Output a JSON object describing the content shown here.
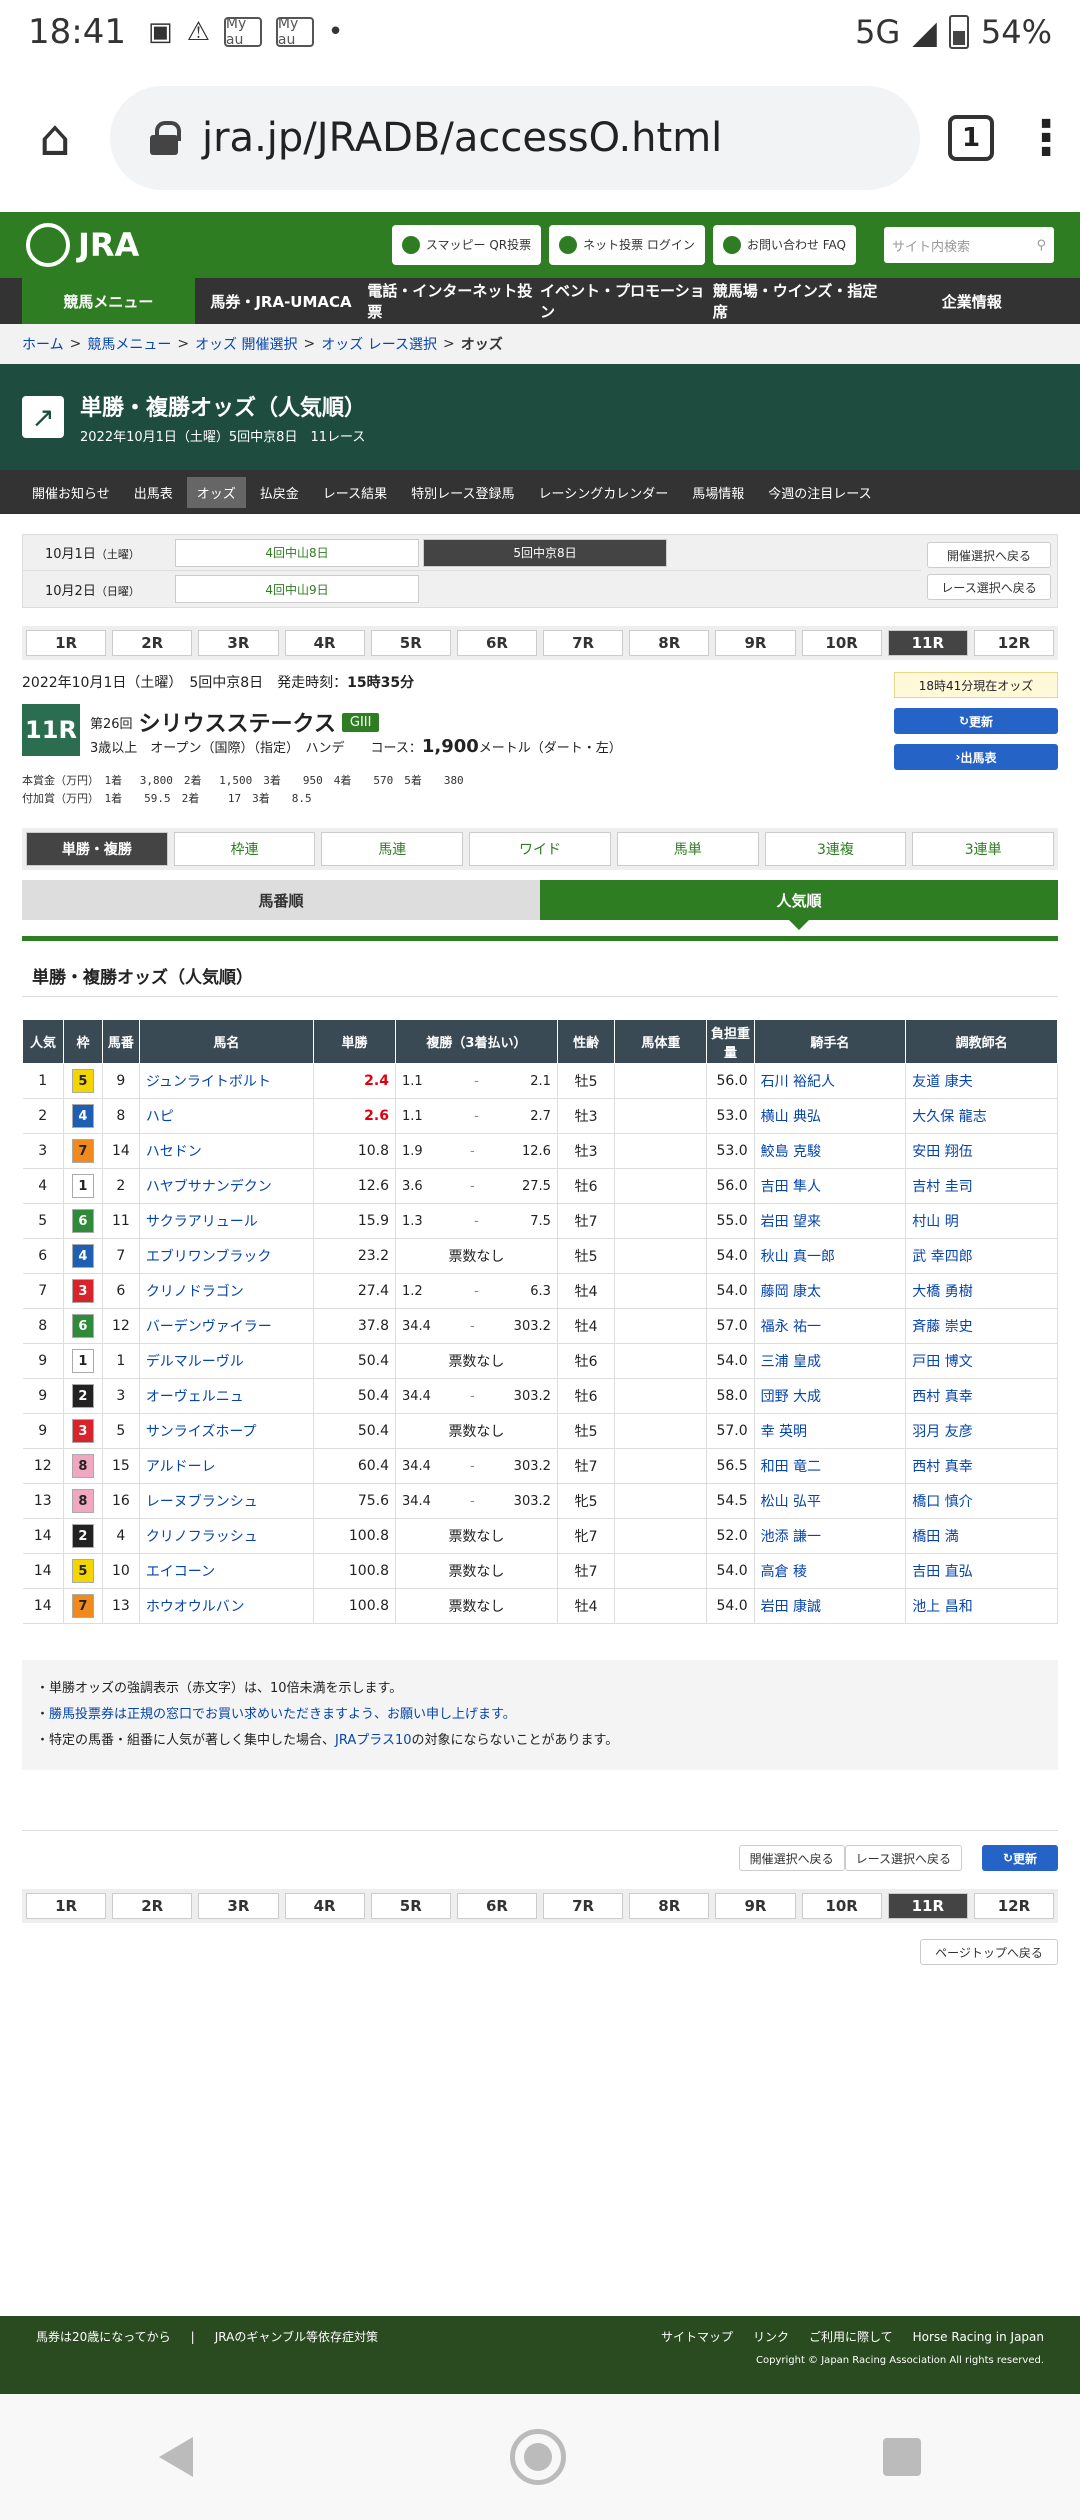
{
  "statusbar": {
    "time": "18:41",
    "network": "5G",
    "battery": "54%",
    "icon1": "My au",
    "icon2": "My au"
  },
  "browser": {
    "url": "jra.jp/JRADB/accessO.html",
    "tab_count": "1"
  },
  "header": {
    "logo": "JRA",
    "btn_smappy": "スマッピー QR投票",
    "btn_net": "ネット投票 ログイン",
    "btn_faq": "お問い合わせ FAQ",
    "search_placeholder": "サイト内検索"
  },
  "nav": [
    "競馬メニュー",
    "馬券・JRA-UMACA",
    "電話・インターネット投票",
    "イベント・プロモーション",
    "競馬場・ウインズ・指定席",
    "企業情報"
  ],
  "breadcrumb": [
    "ホーム",
    "競馬メニュー",
    "オッズ 開催選択",
    "オッズ レース選択",
    "オッズ"
  ],
  "title": {
    "main": "単勝・複勝オッズ（人気順）",
    "sub": "2022年10月1日（土曜）5回中京8日　11レース"
  },
  "subnav": [
    "開催お知らせ",
    "出馬表",
    "オッズ",
    "払戻金",
    "レース結果",
    "特別レース登録馬",
    "レーシングカレンダー",
    "馬場情報",
    "今週の注目レース"
  ],
  "days": [
    {
      "label": "10月1日",
      "dow": "（土曜）",
      "btn1": "4回中山8日",
      "btn2": "5回中京8日"
    },
    {
      "label": "10月2日",
      "dow": "（日曜）",
      "btn1": "4回中山9日"
    }
  ],
  "back_meeting": "開催選択へ戻る",
  "back_race": "レース選択へ戻る",
  "races": [
    "1R",
    "2R",
    "3R",
    "4R",
    "5R",
    "6R",
    "7R",
    "8R",
    "9R",
    "10R",
    "11R",
    "12R"
  ],
  "race": {
    "date_line": "2022年10月1日（土曜）　5回中京8日　発走時刻：",
    "post_time": "15時35分",
    "number": "11R",
    "kai": "第26回",
    "name": "シリウスステークス",
    "grade": "GIII",
    "cond": "3歳以上　オープン（国際）（指定）　ハンデ　　コース：",
    "distance": "1,900",
    "course": "メートル（ダート・左）",
    "prize1": "本賞金（万円）　1着　 3,800　2着　 1,500　3着　　950　4着　　570　5着　　380",
    "prize2": "付加賞（万円）　1着　　59.5　2着　　 17　3着　　8.5",
    "odds_time": "18時41分現在オッズ",
    "update": "更新",
    "shutuba": "出馬表"
  },
  "bettabs": [
    "単勝・複勝",
    "枠連",
    "馬連",
    "ワイド",
    "馬単",
    "3連複",
    "3連単"
  ],
  "sorttabs": [
    "馬番順",
    "人気順"
  ],
  "section_title": "単勝・複勝オッズ（人気順）",
  "table": {
    "headers": [
      "人気",
      "枠",
      "馬番",
      "馬名",
      "単勝",
      "複勝（3着払い）",
      "性齢",
      "馬体重",
      "負担重量",
      "騎手名",
      "調教師名"
    ],
    "rows": [
      {
        "pop": "1",
        "waku": "5",
        "num": "9",
        "name": "ジュンライトボルト",
        "win": "2.4",
        "red": true,
        "plo": "1.1",
        "phi": "2.1",
        "sex": "牡5",
        "wt": "56.0",
        "jockey": "石川 裕紀人",
        "trainer": "友道 康夫"
      },
      {
        "pop": "2",
        "waku": "4",
        "num": "8",
        "name": "ハピ",
        "win": "2.6",
        "red": true,
        "plo": "1.1",
        "phi": "2.7",
        "sex": "牡3",
        "wt": "53.0",
        "jockey": "横山 典弘",
        "trainer": "大久保 龍志"
      },
      {
        "pop": "3",
        "waku": "7",
        "num": "14",
        "name": "ハセドン",
        "win": "10.8",
        "plo": "1.9",
        "phi": "12.6",
        "sex": "牡3",
        "wt": "53.0",
        "jockey": "鮫島 克駿",
        "trainer": "安田 翔伍"
      },
      {
        "pop": "4",
        "waku": "1",
        "num": "2",
        "name": "ハヤブサナンデクン",
        "win": "12.6",
        "plo": "3.6",
        "phi": "27.5",
        "sex": "牡6",
        "wt": "56.0",
        "jockey": "吉田 隼人",
        "trainer": "吉村 圭司"
      },
      {
        "pop": "5",
        "waku": "6",
        "num": "11",
        "name": "サクラアリュール",
        "win": "15.9",
        "plo": "1.3",
        "phi": "7.5",
        "sex": "牡7",
        "wt": "55.0",
        "jockey": "岩田 望来",
        "trainer": "村山 明"
      },
      {
        "pop": "6",
        "waku": "4",
        "num": "7",
        "name": "エブリワンブラック",
        "win": "23.2",
        "none": "票数なし",
        "sex": "牡5",
        "wt": "54.0",
        "jockey": "秋山 真一郎",
        "trainer": "武 幸四郎"
      },
      {
        "pop": "7",
        "waku": "3",
        "num": "6",
        "name": "クリノドラゴン",
        "win": "27.4",
        "plo": "1.2",
        "phi": "6.3",
        "sex": "牡4",
        "wt": "54.0",
        "jockey": "藤岡 康太",
        "trainer": "大橋 勇樹"
      },
      {
        "pop": "8",
        "waku": "6",
        "num": "12",
        "name": "バーデンヴァイラー",
        "win": "37.8",
        "plo": "34.4",
        "phi": "303.2",
        "sex": "牡4",
        "wt": "57.0",
        "jockey": "福永 祐一",
        "trainer": "斉藤 崇史"
      },
      {
        "pop": "9",
        "waku": "1",
        "num": "1",
        "name": "デルマルーヴル",
        "win": "50.4",
        "none": "票数なし",
        "sex": "牡6",
        "wt": "54.0",
        "jockey": "三浦 皇成",
        "trainer": "戸田 博文"
      },
      {
        "pop": "9",
        "waku": "2",
        "num": "3",
        "name": "オーヴェルニュ",
        "win": "50.4",
        "plo": "34.4",
        "phi": "303.2",
        "sex": "牡6",
        "wt": "58.0",
        "jockey": "団野 大成",
        "trainer": "西村 真幸"
      },
      {
        "pop": "9",
        "waku": "3",
        "num": "5",
        "name": "サンライズホープ",
        "win": "50.4",
        "none": "票数なし",
        "sex": "牡5",
        "wt": "57.0",
        "jockey": "幸 英明",
        "trainer": "羽月 友彦"
      },
      {
        "pop": "12",
        "waku": "8",
        "num": "15",
        "name": "アルドーレ",
        "win": "60.4",
        "plo": "34.4",
        "phi": "303.2",
        "sex": "牡7",
        "wt": "56.5",
        "jockey": "和田 竜二",
        "trainer": "西村 真幸"
      },
      {
        "pop": "13",
        "waku": "8",
        "num": "16",
        "name": "レーヌブランシュ",
        "win": "75.6",
        "plo": "34.4",
        "phi": "303.2",
        "sex": "牝5",
        "wt": "54.5",
        "jockey": "松山 弘平",
        "trainer": "橋口 慎介"
      },
      {
        "pop": "14",
        "waku": "2",
        "num": "4",
        "name": "クリノフラッシュ",
        "win": "100.8",
        "none": "票数なし",
        "sex": "牝7",
        "wt": "52.0",
        "jockey": "池添 謙一",
        "trainer": "橋田 満"
      },
      {
        "pop": "14",
        "waku": "5",
        "num": "10",
        "name": "エイコーン",
        "win": "100.8",
        "none": "票数なし",
        "sex": "牡7",
        "wt": "54.0",
        "jockey": "高倉 稜",
        "trainer": "吉田 直弘"
      },
      {
        "pop": "14",
        "waku": "7",
        "num": "13",
        "name": "ホウオウルバン",
        "win": "100.8",
        "none": "票数なし",
        "sex": "牡4",
        "wt": "54.0",
        "jockey": "岩田 康誠",
        "trainer": "池上 昌和"
      }
    ]
  },
  "notes": {
    "n1": "単勝オッズの強調表示（赤文字）は、10倍未満を示します。",
    "n2": "勝馬投票券は正規の窓口でお買い求めいただきますよう、お願い申し上げます。",
    "n3a": "特定の馬番・組番に人気が著しく集中した場合、",
    "n3link": "JRAプラス10",
    "n3b": "の対象にならないことがあります。"
  },
  "page_top": "ページトップへ戻る",
  "footer": {
    "l1": "馬券は20歳になってから",
    "l2": "JRAのギャンブル等依存症対策",
    "r1": "サイトマップ",
    "r2": "リンク",
    "r3": "ご利用に際して",
    "r4": "Horse Racing in Japan",
    "copy": "Copyright © Japan Racing Association All rights reserved."
  },
  "waku_colors": {
    "1": "#ffffff",
    "2": "#222222",
    "3": "#d8232a",
    "4": "#1e5fb3",
    "5": "#f3d600",
    "6": "#2f8a3a",
    "7": "#f08a1d",
    "8": "#f2a7c1"
  }
}
